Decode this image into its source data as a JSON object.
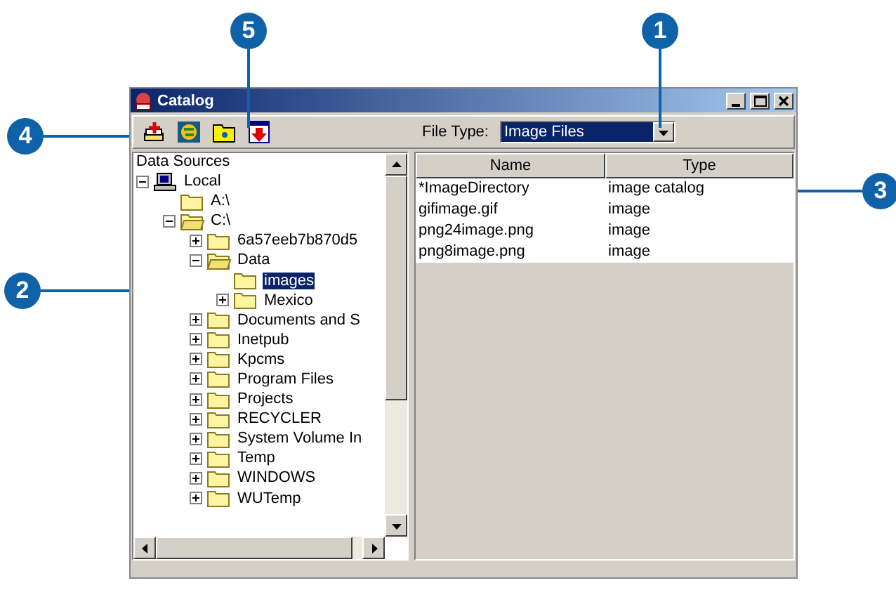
{
  "window": {
    "title": "Catalog"
  },
  "toolbar": {
    "file_type_label": "File Type:",
    "file_type_value": "Image Files"
  },
  "tree": {
    "root": "Data Sources",
    "items": [
      {
        "label": "Local",
        "kind": "computer",
        "expanded": true,
        "selected": false,
        "children": [
          {
            "label": "A:\\",
            "kind": "folder",
            "selected": false
          },
          {
            "label": "C:\\",
            "kind": "folder",
            "expanded": true,
            "selected": false,
            "children": [
              {
                "label": "6a57eeb7b870d5",
                "kind": "folder",
                "expanded": false,
                "selected": false
              },
              {
                "label": "Data",
                "kind": "folder",
                "expanded": true,
                "selected": false,
                "children": [
                  {
                    "label": "images",
                    "kind": "folder",
                    "selected": true
                  },
                  {
                    "label": "Mexico",
                    "kind": "folder",
                    "expanded": false,
                    "selected": false
                  }
                ]
              },
              {
                "label": "Documents and S",
                "kind": "folder",
                "expanded": false,
                "selected": false
              },
              {
                "label": "Inetpub",
                "kind": "folder",
                "expanded": false,
                "selected": false
              },
              {
                "label": "Kpcms",
                "kind": "folder",
                "expanded": false,
                "selected": false
              },
              {
                "label": "Program Files",
                "kind": "folder",
                "expanded": false,
                "selected": false
              },
              {
                "label": "Projects",
                "kind": "folder",
                "expanded": false,
                "selected": false
              },
              {
                "label": "RECYCLER",
                "kind": "folder",
                "expanded": false,
                "selected": false
              },
              {
                "label": "System Volume In",
                "kind": "folder",
                "expanded": false,
                "selected": false
              },
              {
                "label": "Temp",
                "kind": "folder",
                "expanded": false,
                "selected": false
              },
              {
                "label": "WINDOWS",
                "kind": "folder",
                "expanded": false,
                "selected": false
              },
              {
                "label": "WUTemp",
                "kind": "folder",
                "expanded": false,
                "selected": false
              }
            ]
          }
        ]
      }
    ]
  },
  "table": {
    "columns": [
      "Name",
      "Type"
    ],
    "rows": [
      [
        "*ImageDirectory",
        "image catalog"
      ],
      [
        "gifimage.gif",
        "image"
      ],
      [
        "png24image.png",
        "image"
      ],
      [
        "png8image.png",
        "image"
      ]
    ]
  },
  "callouts": [
    {
      "label": "1"
    },
    {
      "label": "2"
    },
    {
      "label": "3"
    },
    {
      "label": "4"
    },
    {
      "label": "5"
    }
  ]
}
